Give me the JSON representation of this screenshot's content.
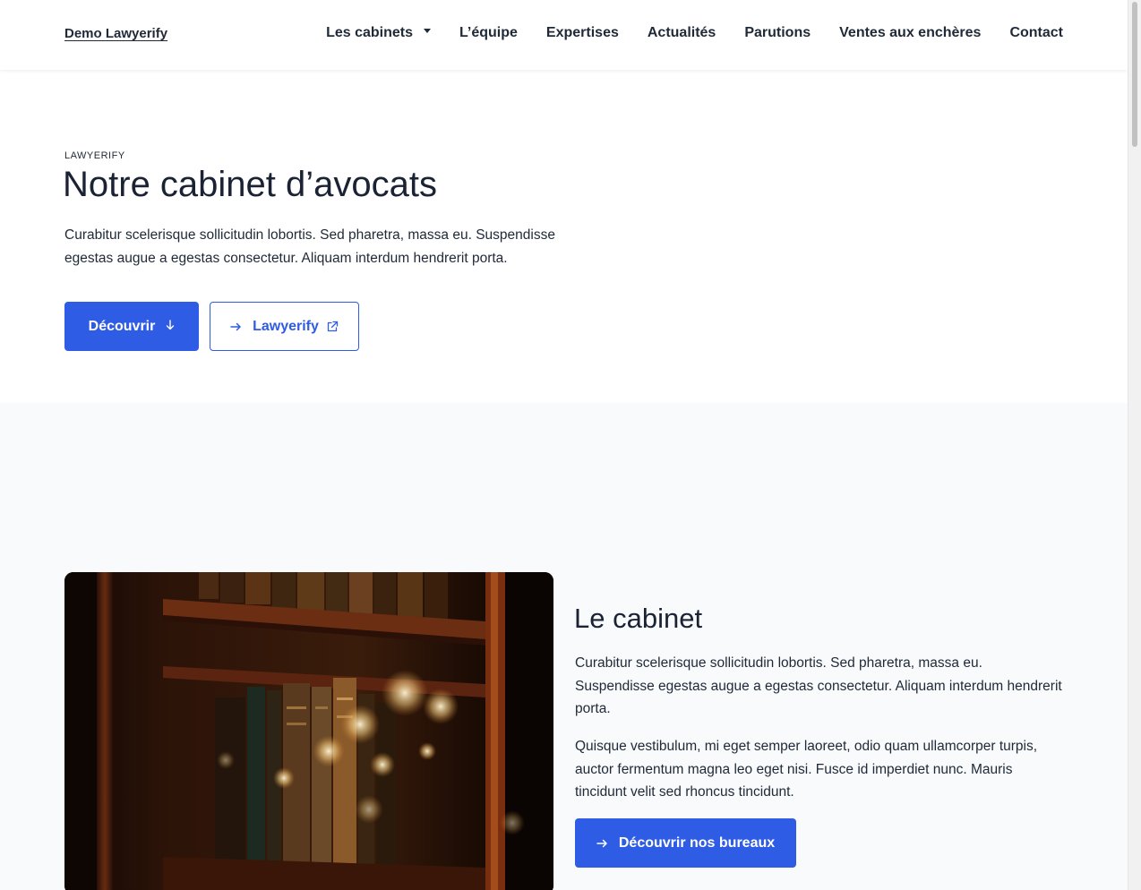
{
  "header": {
    "brand": "Demo Lawyerify",
    "nav": [
      {
        "label": "Les cabinets",
        "has_dropdown": true
      },
      {
        "label": "L’équipe"
      },
      {
        "label": "Expertises"
      },
      {
        "label": "Actualités"
      },
      {
        "label": "Parutions"
      },
      {
        "label": "Ventes aux enchères"
      },
      {
        "label": "Contact"
      }
    ]
  },
  "hero": {
    "eyebrow": "LAWYERIFY",
    "title": "Notre cabinet d’avocats",
    "text": "Curabitur scelerisque sollicitudin lobortis. Sed pharetra, massa eu. Suspendisse egestas augue a egestas consectetur. Aliquam interdum hendrerit porta.",
    "primary_button": {
      "label": "Découvrir",
      "icon": "arrow-down-icon"
    },
    "secondary_button": {
      "label": "Lawyerify",
      "icon_left": "arrow-right-icon",
      "icon_right": "external-link-icon"
    }
  },
  "section": {
    "image": "bookshelf-photo",
    "title": "Le cabinet",
    "paragraph1": "Curabitur scelerisque sollicitudin lobortis. Sed pharetra, massa eu. Suspendisse egestas augue a egestas consectetur. Aliquam interdum hendrerit porta.",
    "paragraph2": "Quisque vestibulum, mi eget semper laoreet, odio quam ullamcorper turpis, auctor fermentum magna leo eget nisi. Fusce id imperdiet nunc. Mauris tincidunt velit sed rhoncus tincidunt.",
    "button": {
      "label": "Découvrir nos bureaux",
      "icon": "arrow-right-icon"
    }
  },
  "colors": {
    "accent": "#2f5ce5",
    "text": "#1f2937",
    "heading": "#1a2234",
    "section_bg": "#f8fafc"
  }
}
